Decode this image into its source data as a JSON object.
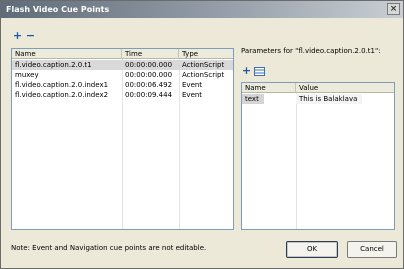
{
  "window": {
    "title": "Flash Video Cue Points"
  },
  "toolbar": {
    "add_symbol": "+",
    "remove_symbol": "−"
  },
  "cue_points": {
    "columns": [
      "Name",
      "Time",
      "Type"
    ],
    "rows": [
      [
        "fl.video.caption.2.0.t1",
        "00:00:00.000",
        "ActionScript"
      ],
      [
        "muxey",
        "00:00:00.000",
        "ActionScript"
      ],
      [
        "fl.video.caption.2.0.index1",
        "00:00:06.492",
        "Event"
      ],
      [
        "fl.video.caption.2.0.index2",
        "00:00:09.444",
        "Event"
      ]
    ]
  },
  "parameters": {
    "label": "Parameters for \"fl.video.caption.2.0.t1\":",
    "add_symbol": "+",
    "columns": [
      "Name",
      "Value"
    ],
    "rows": [
      [
        "text",
        "This is Balaklava"
      ]
    ]
  },
  "footer": {
    "note": "Note: Event and Navigation cue points are not editable.",
    "ok_label": "OK",
    "cancel_label": "Cancel"
  }
}
